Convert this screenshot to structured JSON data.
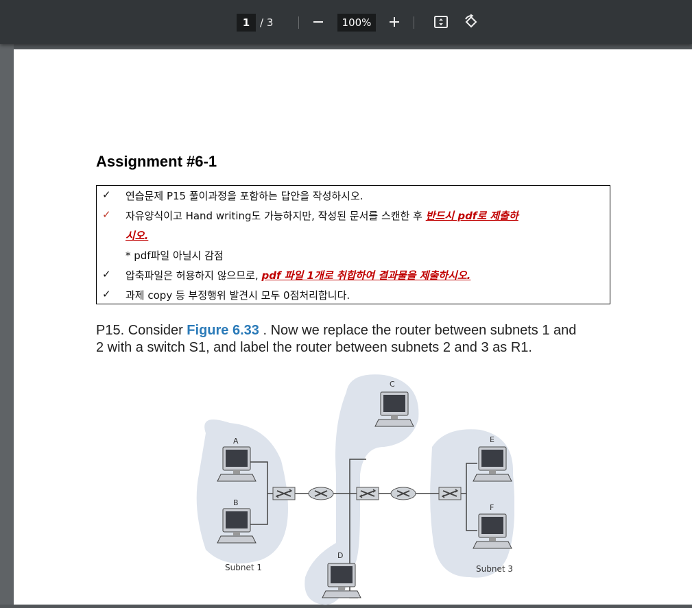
{
  "toolbar": {
    "page_current": "1",
    "page_total": "/ 3",
    "zoom": "100%",
    "zoom_out_glyph": "—",
    "zoom_in_glyph": "+",
    "icons": [
      "minus-icon",
      "plus-icon",
      "fit-page-icon",
      "rotate-icon"
    ]
  },
  "doc": {
    "title": "Assignment #6-1",
    "rules": [
      {
        "check": "✓",
        "check_color": "#000000",
        "text": "연습문제 P15 풀이과정을 포함하는 답안을 작성하시오."
      },
      {
        "check": "✓",
        "check_color": "#c0392b",
        "text": "자유양식이고 Hand writing도 가능하지만, 작성된 문서를 스캔한 후 ",
        "emph": "반드시 pdf로 제출하",
        "cont": "시오."
      },
      {
        "check": "",
        "text": "* pdf파일 아닐시 감점"
      },
      {
        "check": "✓",
        "check_color": "#000000",
        "text": "압축파일은 허용하지 않으므로, ",
        "emph": "pdf 파일 1개로 취합하여 결과물을 제출하시오."
      },
      {
        "check": "✓",
        "check_color": "#000000",
        "text": "과제 copy 등 부정행위 발견시 모두 0점처리합니다."
      }
    ],
    "para_pre": "P15. Consider ",
    "para_fig": "Figure 6.33",
    "para_line1_post": " . Now we replace the router between subnets 1 and",
    "para_line2": "2 with a switch S1, and label the router between subnets 2 and 3 as R1."
  },
  "figure": {
    "hosts": [
      "A",
      "B",
      "C",
      "D",
      "E",
      "F"
    ],
    "subnet1": "Subnet 1",
    "subnet3": "Subnet 3",
    "bubble_color": "#dde3ec"
  }
}
